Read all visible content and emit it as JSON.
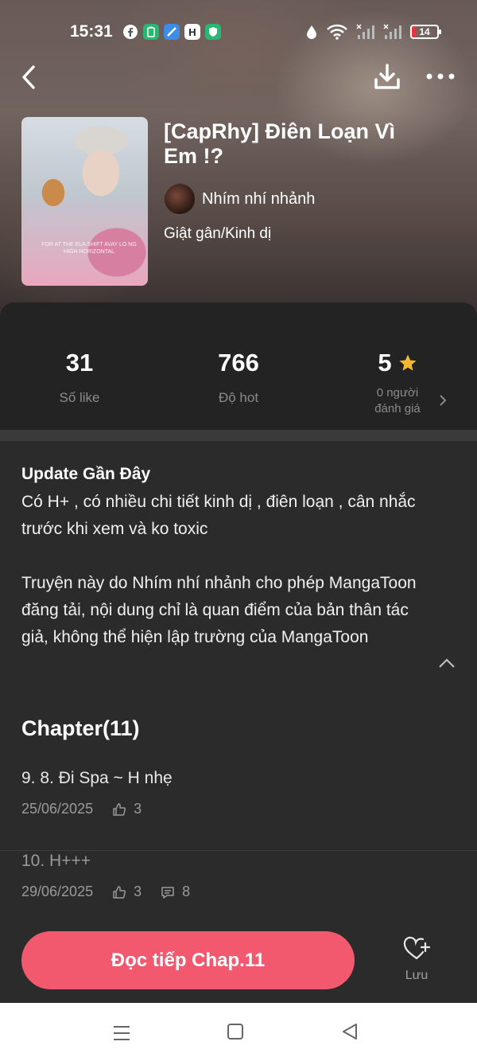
{
  "status_bar": {
    "time": "15:31",
    "battery": "14",
    "app_icons": [
      "facebook-icon",
      "battery-saver-icon",
      "browser-icon",
      "h-app-icon",
      "shield-app-icon"
    ]
  },
  "header": {
    "back_icon": "chevron-left-icon",
    "download_icon": "download-icon",
    "more_icon": "more-dots-icon"
  },
  "comic": {
    "cover_caption": "FOR AT THE ELA SHIFT AVAY LO NG HIGH HORIZONTAL",
    "title": "[CapRhy] Điên Loạn Vì Em !?",
    "author": "Nhím nhí nhảnh",
    "genre": "Giật gân/Kinh dị"
  },
  "stats": {
    "likes_value": "31",
    "likes_label": "Số like",
    "hot_value": "766",
    "hot_label": "Độ hot",
    "rating_value": "5",
    "rating_label_line1": "0 người",
    "rating_label_line2": "đánh giá"
  },
  "update": {
    "heading": "Update Gần Đây",
    "body": "Có H+ , có nhiều chi tiết kinh dị , điên loạn , cân nhắc trước khi xem và ko toxic",
    "license": "Truyện này do Nhím nhí nhảnh cho phép MangaToon đăng tải, nội dung chỉ là quan điểm của bản thân tác giả, không thể hiện lập trường của MangaToon"
  },
  "chapters": {
    "heading": "Chapter(11)",
    "items": [
      {
        "title": "9. 8. Đi Spa ~ H nhẹ",
        "date": "25/06/2025",
        "likes": "3",
        "comments": null,
        "read": false
      },
      {
        "title": "10. H+++",
        "date": "29/06/2025",
        "likes": "3",
        "comments": "8",
        "read": true
      }
    ]
  },
  "actions": {
    "continue_label": "Đọc tiếp Chap.11",
    "save_label": "Lưu"
  },
  "colors": {
    "accent": "#f2596e",
    "star": "#f5b82e",
    "background": "#2b2b2b"
  }
}
